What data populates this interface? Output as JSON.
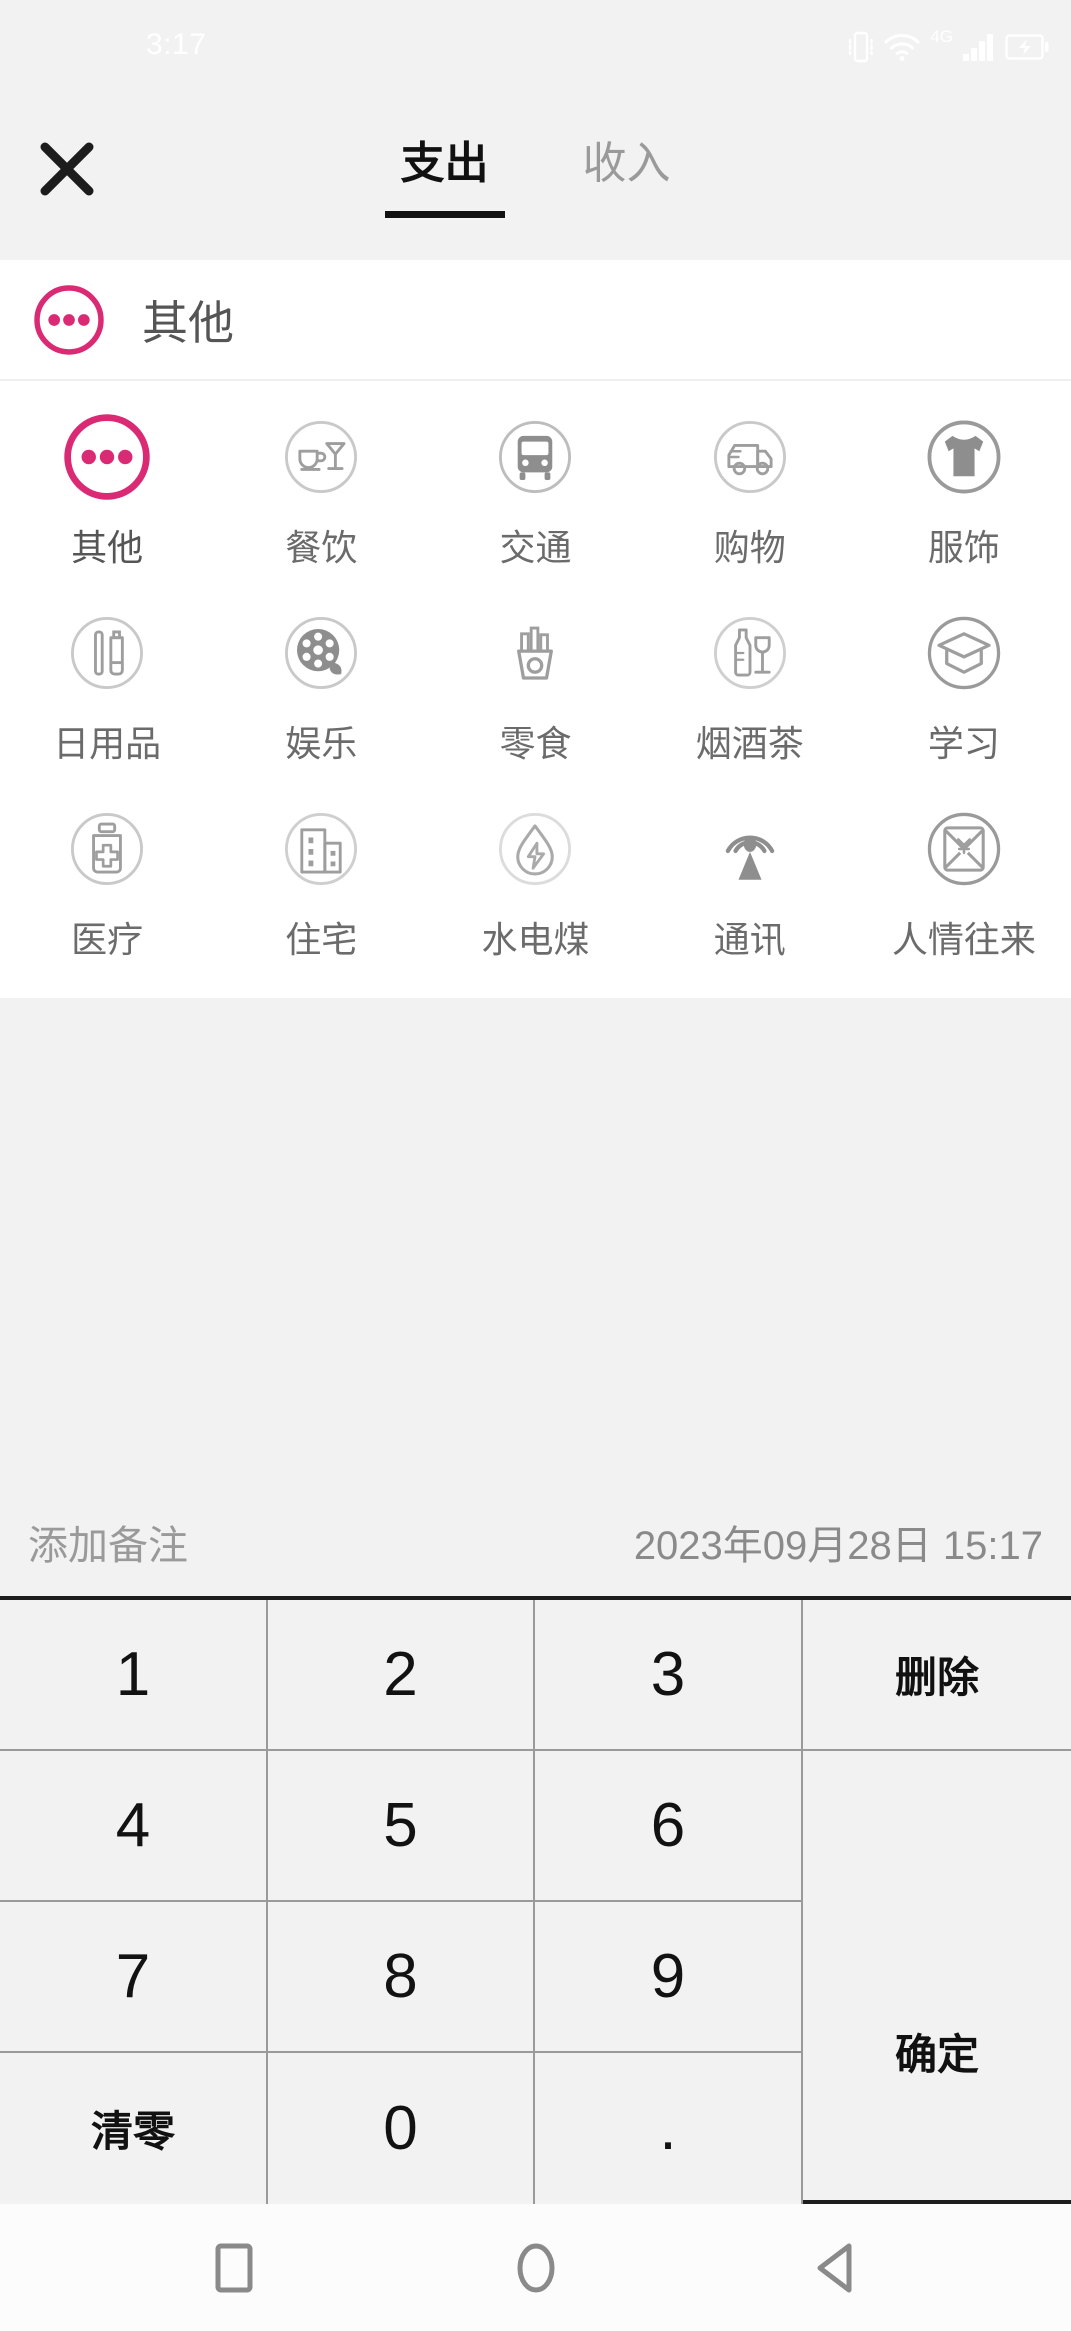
{
  "status_bar": {
    "time": "3:17",
    "icons": [
      "vibrate-icon",
      "wifi-icon",
      "network-4g-icon",
      "signal-bars-icon",
      "battery-charging-icon"
    ],
    "network_label": "4G"
  },
  "top_bar": {
    "close_label": "✕",
    "tabs": [
      {
        "label": "支出",
        "active": true
      },
      {
        "label": "收入",
        "active": false
      }
    ]
  },
  "selected_category": {
    "icon": "ellipsis-circle-icon",
    "label": "其他",
    "accent_color": "#DB2A74"
  },
  "categories": [
    {
      "label": "其他",
      "icon": "ellipsis-circle-icon",
      "selected": true
    },
    {
      "label": "餐饮",
      "icon": "dining-icon",
      "selected": false
    },
    {
      "label": "交通",
      "icon": "bus-icon",
      "selected": false
    },
    {
      "label": "购物",
      "icon": "delivery-truck-icon",
      "selected": false
    },
    {
      "label": "服饰",
      "icon": "tshirt-icon",
      "selected": false
    },
    {
      "label": "日用品",
      "icon": "toiletries-icon",
      "selected": false
    },
    {
      "label": "娱乐",
      "icon": "film-reel-icon",
      "selected": false
    },
    {
      "label": "零食",
      "icon": "fries-icon",
      "selected": false
    },
    {
      "label": "烟酒茶",
      "icon": "bottle-glass-icon",
      "selected": false
    },
    {
      "label": "学习",
      "icon": "graduation-cap-icon",
      "selected": false
    },
    {
      "label": "医疗",
      "icon": "medicine-bottle-icon",
      "selected": false
    },
    {
      "label": "住宅",
      "icon": "building-icon",
      "selected": false
    },
    {
      "label": "水电煤",
      "icon": "utility-drop-icon",
      "selected": false
    },
    {
      "label": "通讯",
      "icon": "signal-tower-icon",
      "selected": false
    },
    {
      "label": "人情往来",
      "icon": "red-envelope-icon",
      "selected": false
    }
  ],
  "note_row": {
    "note_placeholder": "添加备注",
    "note_value": "",
    "date_time": "2023年09月28日 15:17"
  },
  "keypad": {
    "keys": [
      "1",
      "2",
      "3",
      "4",
      "5",
      "6",
      "7",
      "8",
      "9",
      "0"
    ],
    "delete_label": "删除",
    "clear_label": "清零",
    "confirm_label": "确定",
    "dot_label": "."
  },
  "nav_bar": {
    "buttons": [
      "recents-square-icon",
      "home-circle-icon",
      "back-triangle-icon"
    ]
  },
  "colors": {
    "accent_pink": "#DB2A74",
    "background_gray": "#F2F2F2",
    "panel_white": "#FFFFFF",
    "text_dark": "#111111",
    "text_muted": "#8A8A8A",
    "icon_gray": "#9E9E9E"
  }
}
